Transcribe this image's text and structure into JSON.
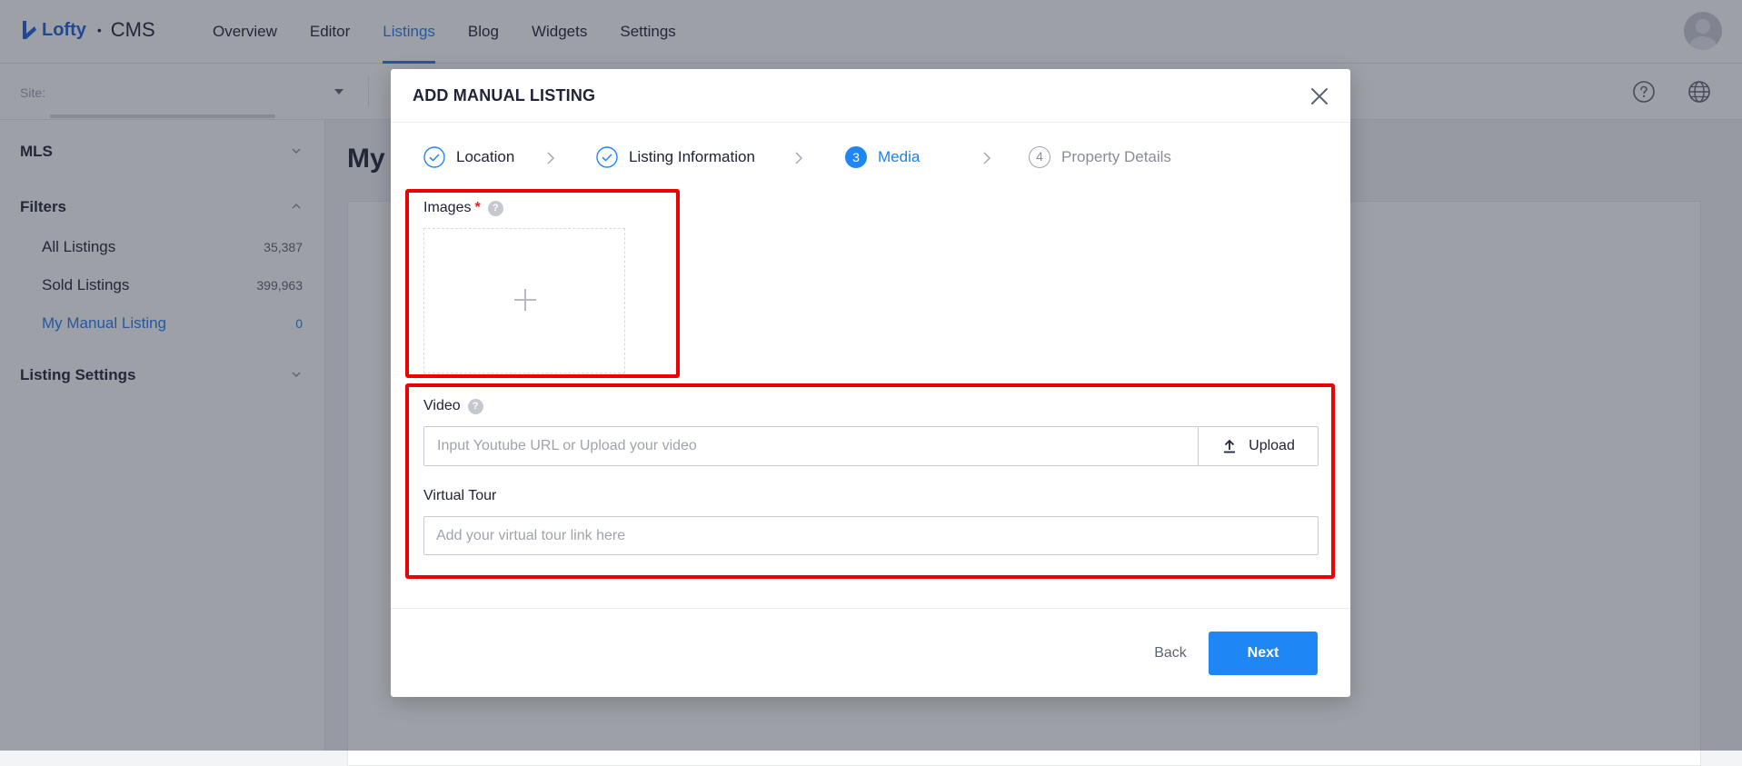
{
  "app": {
    "logo_text": "Lofty",
    "logo_separator": "•",
    "product": "CMS"
  },
  "nav": {
    "tabs": [
      {
        "label": "Overview",
        "active": false
      },
      {
        "label": "Editor",
        "active": false
      },
      {
        "label": "Listings",
        "active": true
      },
      {
        "label": "Blog",
        "active": false
      },
      {
        "label": "Widgets",
        "active": false
      },
      {
        "label": "Settings",
        "active": false
      }
    ]
  },
  "subbar": {
    "site_label": "Site:"
  },
  "sidebar": {
    "mls_label": "MLS",
    "filters_label": "Filters",
    "items": [
      {
        "label": "All Listings",
        "count": "35,387",
        "active": false
      },
      {
        "label": "Sold Listings",
        "count": "399,963",
        "active": false
      },
      {
        "label": "My Manual Listing",
        "count": "0",
        "active": true
      }
    ],
    "listing_settings_label": "Listing Settings"
  },
  "main": {
    "title": "My"
  },
  "modal": {
    "title": "ADD MANUAL LISTING",
    "steps": [
      {
        "label": "Location",
        "state": "done"
      },
      {
        "label": "Listing Information",
        "state": "done"
      },
      {
        "number": "3",
        "label": "Media",
        "state": "active"
      },
      {
        "number": "4",
        "label": "Property Details",
        "state": "todo"
      }
    ],
    "images_label": "Images",
    "required_mark": "*",
    "help_glyph": "?",
    "video_label": "Video",
    "video_placeholder": "Input Youtube URL or Upload your video",
    "upload_label": "Upload",
    "virtual_tour_label": "Virtual Tour",
    "virtual_tour_placeholder": "Add your virtual tour link here",
    "back_label": "Back",
    "next_label": "Next"
  },
  "colors": {
    "brand": "#2060d8",
    "accent": "#1e87f5",
    "highlight": "#ee0000",
    "required": "#e02020"
  }
}
